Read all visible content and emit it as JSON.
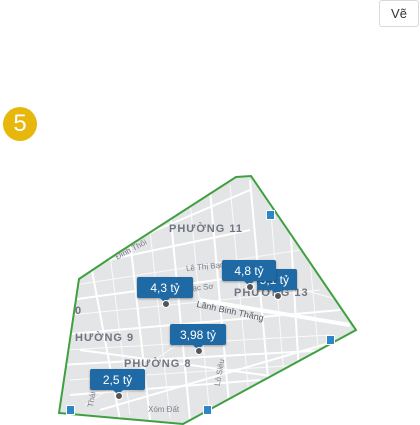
{
  "toolbar": {
    "draw_label": "Vẽ"
  },
  "step": {
    "number": "5"
  },
  "map": {
    "outline_color": "#3fa040",
    "marker_color": "#1f6aa5",
    "districts": [
      "PHƯỜNG 11",
      "PHƯỜNG 13",
      "HƯỜNG 9",
      "PHƯỜNG 8",
      "0"
    ],
    "streets": [
      "Đinh Thôi",
      "Lê Thị Bạch",
      "Lạc Sơ",
      "Lãnh Binh Thăng",
      "Lò Siêu",
      "Xóm Đất",
      "Thái"
    ],
    "price_markers": [
      {
        "label": "4,8 tỷ"
      },
      {
        "label": "5,1 tỷ"
      },
      {
        "label": "4,3 tỷ"
      },
      {
        "label": "3,98 tỷ"
      },
      {
        "label": "2,5 tỷ"
      }
    ],
    "poi_icons": [
      "bus-stop-icon",
      "bus-stop-icon",
      "bus-stop-icon",
      "bus-stop-icon"
    ]
  }
}
